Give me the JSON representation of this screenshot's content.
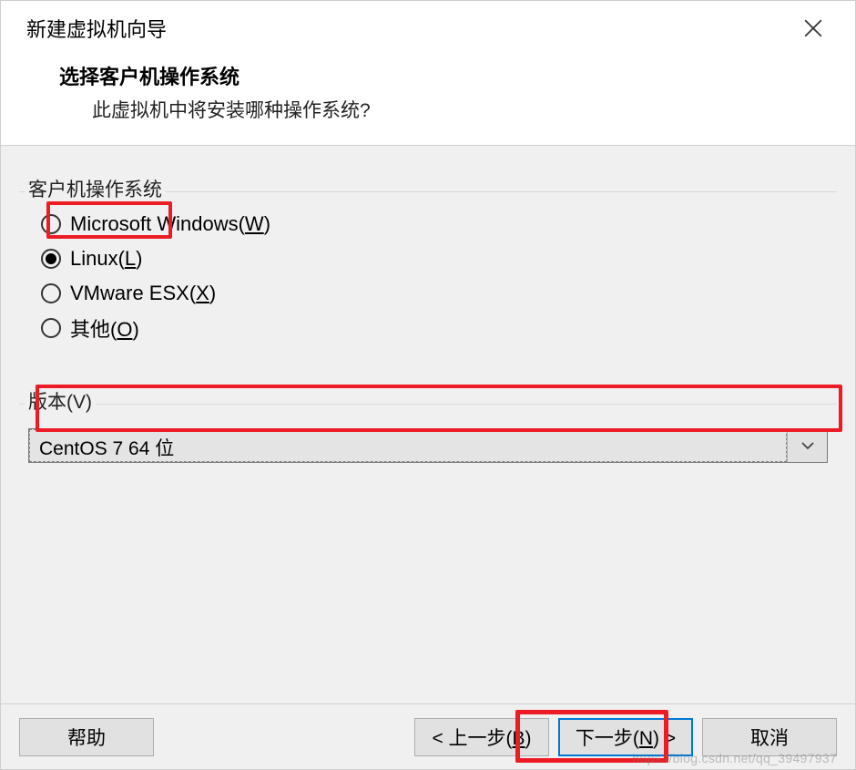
{
  "window": {
    "title": "新建虚拟机向导"
  },
  "header": {
    "heading": "选择客户机操作系统",
    "subtext": "此虚拟机中将安装哪种操作系统?"
  },
  "os_group": {
    "label": "客户机操作系统",
    "options": [
      {
        "text": "Microsoft Windows(",
        "mnemonic": "W",
        "tail": ")",
        "selected": false
      },
      {
        "text": "Linux(",
        "mnemonic": "L",
        "tail": ")",
        "selected": true
      },
      {
        "text": "VMware ESX(",
        "mnemonic": "X",
        "tail": ")",
        "selected": false
      },
      {
        "text": "其他(",
        "mnemonic": "O",
        "tail": ")",
        "selected": false
      }
    ]
  },
  "version_group": {
    "label_pre": "版本(",
    "label_mn": "V",
    "label_post": ")",
    "selected": "CentOS 7 64 位"
  },
  "footer": {
    "help": "帮助",
    "back_pre": "< 上一步(",
    "back_mn": "B",
    "back_post": ")",
    "next_pre": "下一步(",
    "next_mn": "N",
    "next_post": ") >",
    "cancel": "取消"
  },
  "watermark": "https://blog.csdn.net/qq_39497937"
}
